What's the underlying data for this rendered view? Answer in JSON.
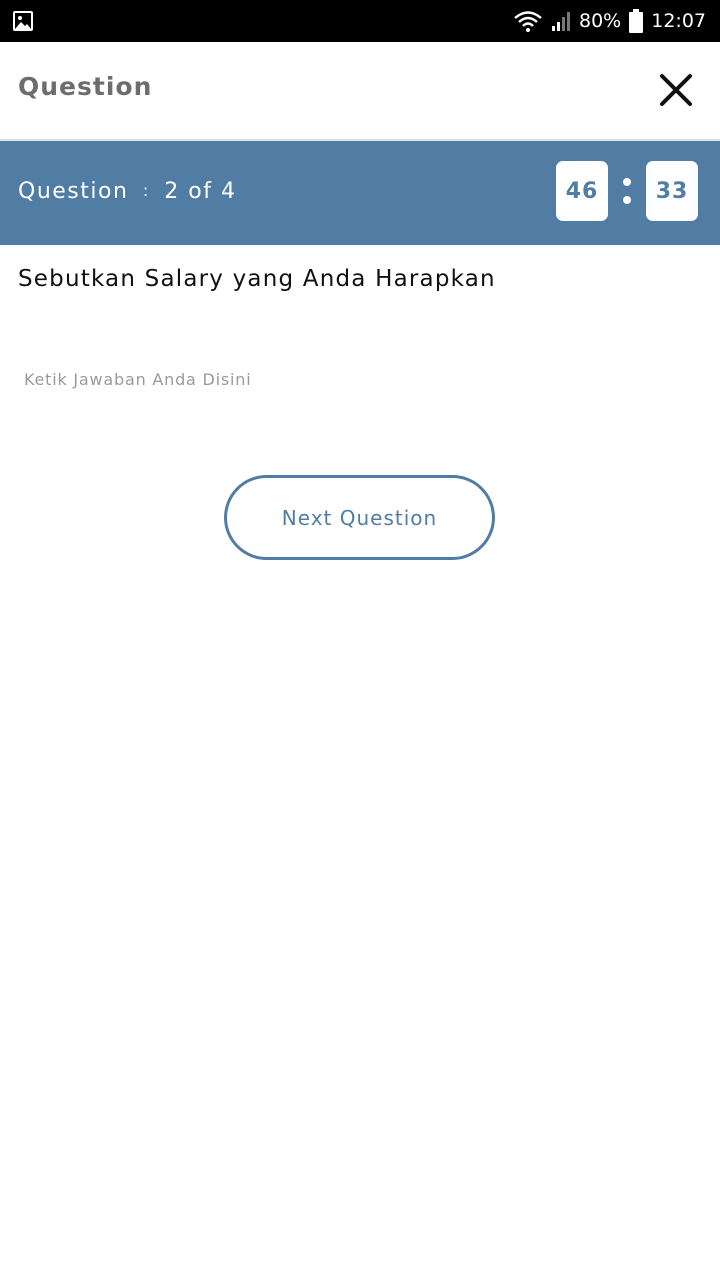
{
  "status_bar": {
    "battery": "80%",
    "time": "12:07",
    "icons": [
      "image-icon",
      "wifi-icon",
      "signal-icon",
      "battery-icon"
    ]
  },
  "header": {
    "title": "Question",
    "close_icon": "close-icon"
  },
  "question_bar": {
    "label": "Question",
    "separator": ":",
    "progress": "2 of 4",
    "timer": {
      "minutes": "46",
      "seconds": "33"
    }
  },
  "question": {
    "text": "Sebutkan Salary yang Anda Harapkan"
  },
  "answer": {
    "placeholder": "Ketik Jawaban Anda Disini",
    "value": ""
  },
  "actions": {
    "next_label": "Next Question"
  },
  "colors": {
    "accent": "#517da4",
    "status_bar": "#000000",
    "header_title": "#6d6d6d",
    "placeholder": "#9a9a9a"
  }
}
